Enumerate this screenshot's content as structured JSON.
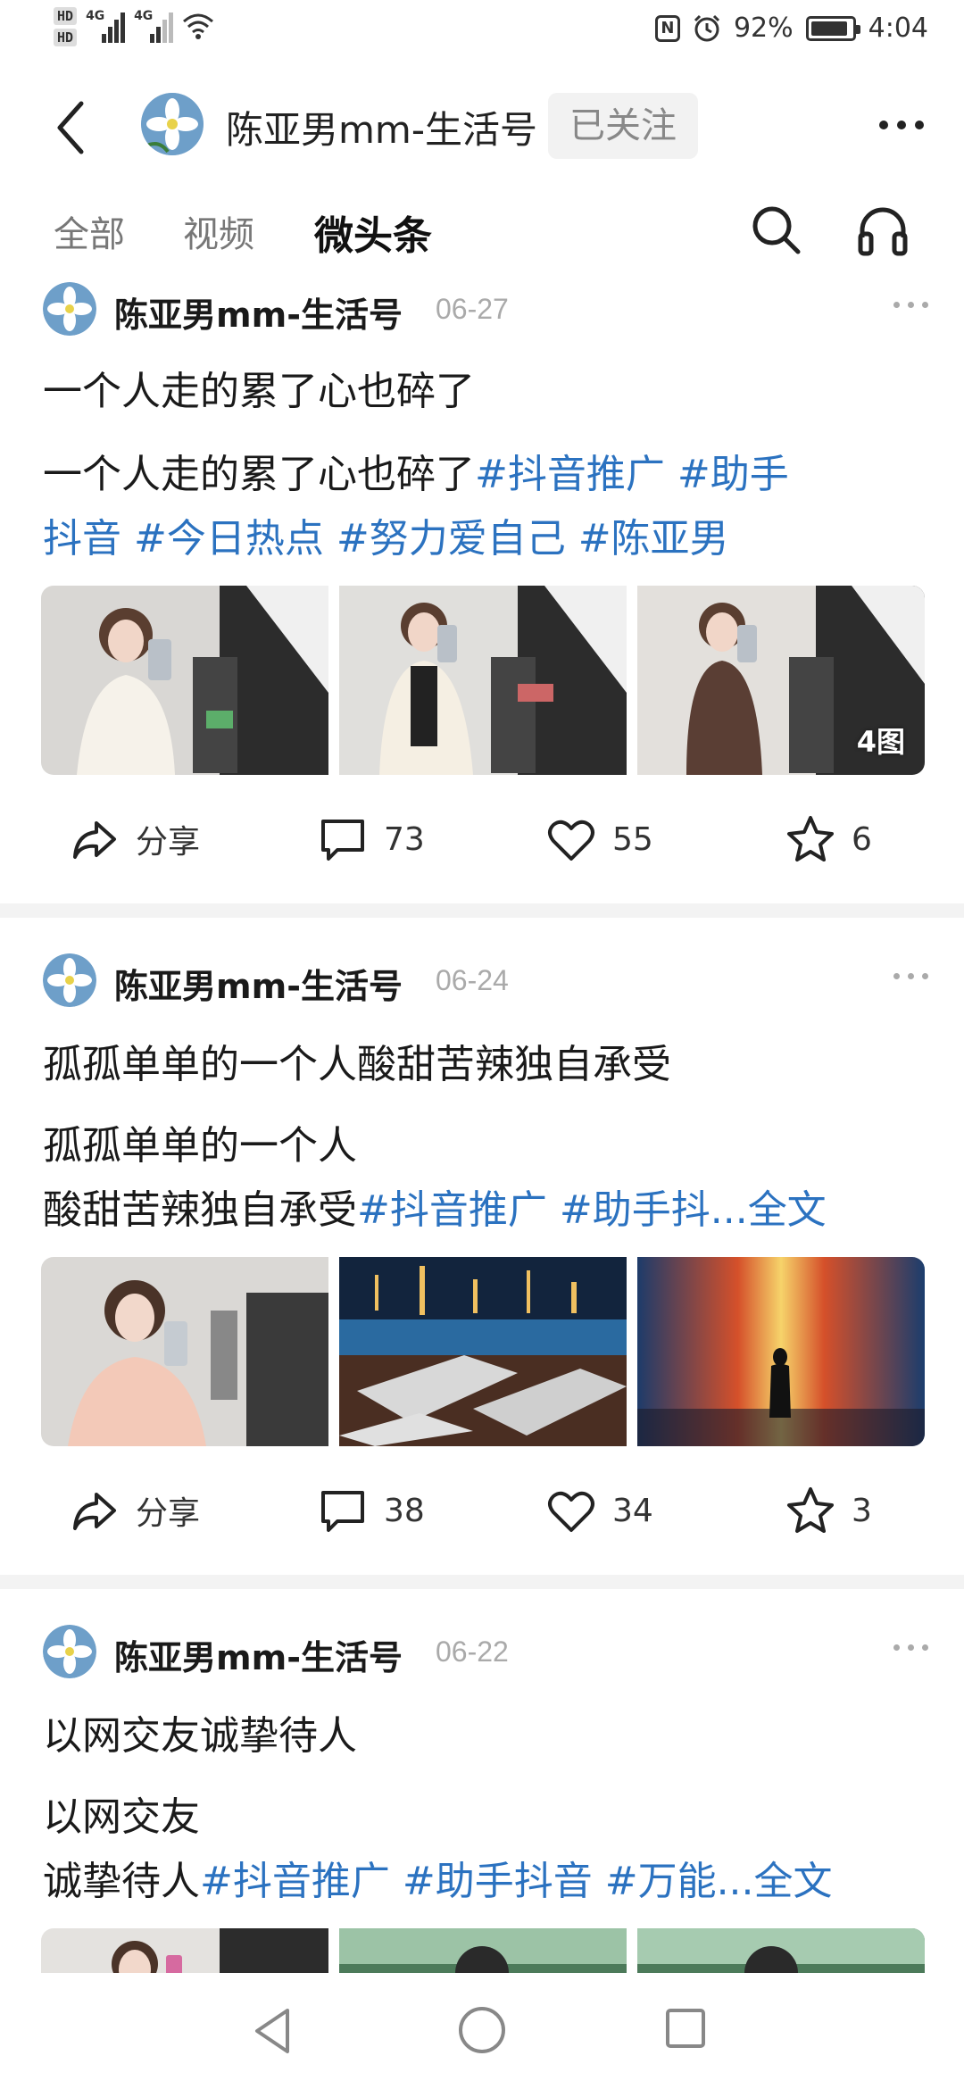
{
  "status_bar": {
    "hd1": "HD",
    "hd2": "HD",
    "net1": "4G",
    "net2": "4G",
    "battery_percent": "92%",
    "battery_level": 0.92,
    "time": "4:04",
    "nfc": "N"
  },
  "header": {
    "back_icon": "chevron-left-icon",
    "account_name": "陈亚男mm-生活号",
    "follow_label": "已关注",
    "more_icon": "more-horizontal-icon"
  },
  "tabs": [
    {
      "label": "全部",
      "active": false
    },
    {
      "label": "视频",
      "active": false
    },
    {
      "label": "微头条",
      "active": true
    }
  ],
  "tab_icons": {
    "search": "search-icon",
    "listen": "headphones-icon"
  },
  "posts": [
    {
      "author": "陈亚男mm-生活号",
      "date": "06-27",
      "title": "一个人走的累了心也碎了",
      "body_line1_text": "一个人走的累了心也碎了",
      "body_line1_tags": "#抖音推广 #助手",
      "body_line2_tags": "抖音 #今日热点 #努力爱自己 #陈亚男",
      "image_count": "4图",
      "share_label": "分享",
      "comments": "73",
      "likes": "55",
      "favorites": "6"
    },
    {
      "author": "陈亚男mm-生活号",
      "date": "06-24",
      "title": "孤孤单单的一个人酸甜苦辣独自承受",
      "body_line1_text": "孤孤单单的一个人",
      "body_line2_text": "酸甜苦辣独自承受",
      "body_line2_tags": "#抖音推广 #助手抖...",
      "full_text_label": "全文",
      "share_label": "分享",
      "comments": "38",
      "likes": "34",
      "favorites": "3"
    },
    {
      "author": "陈亚男mm-生活号",
      "date": "06-22",
      "title": "以网交友诚挚待人",
      "body_line1_text": "以网交友",
      "body_line2_text": "诚挚待人",
      "body_line2_tags": "#抖音推广 #助手抖音 #万能...",
      "full_text_label": "全文"
    }
  ],
  "nav_bar": {
    "back": "triangle-back-icon",
    "home": "circle-home-icon",
    "recent": "square-recent-icon"
  },
  "colors": {
    "link": "#2b72c0",
    "text": "#1a1a1a",
    "muted": "#aaaaaa",
    "follow_bg": "#f2f2f2"
  }
}
